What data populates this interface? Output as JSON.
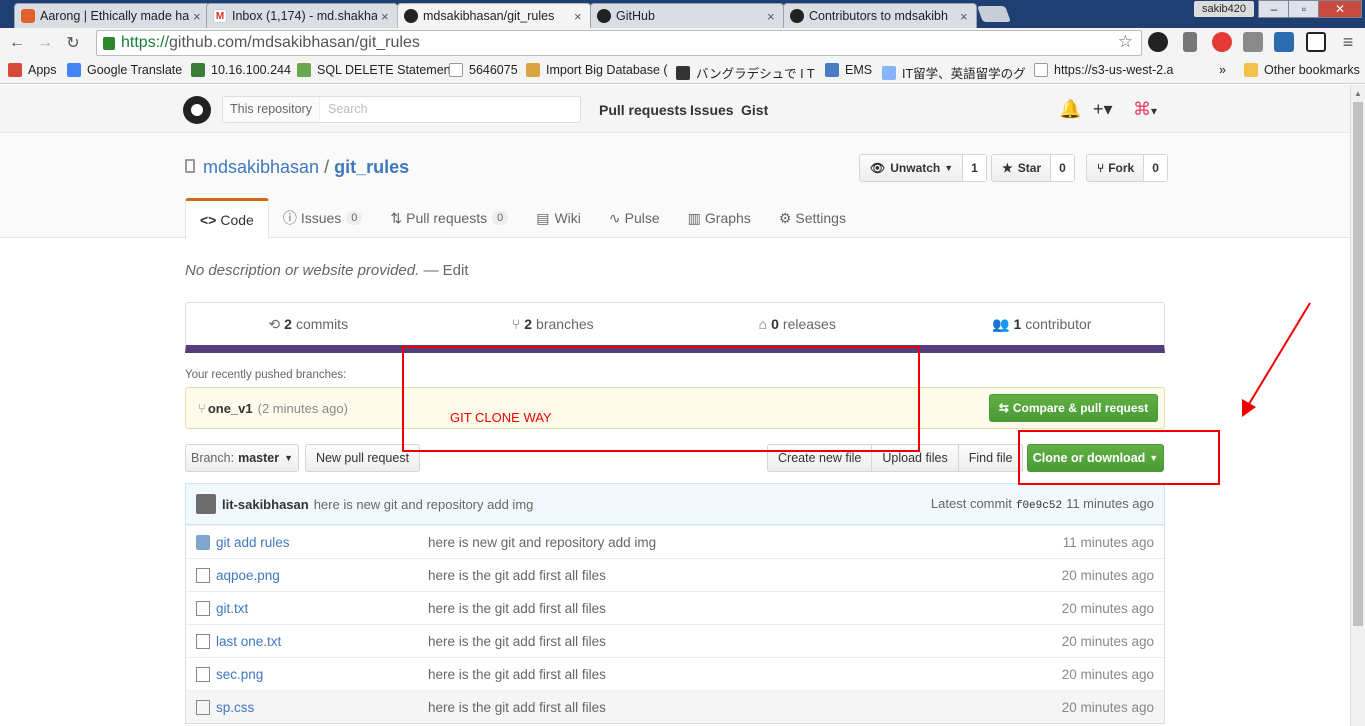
{
  "browser": {
    "tabs": [
      {
        "title": "Aarong | Ethically made ha",
        "favicon_color": "#e0632f"
      },
      {
        "title": "Inbox (1,174) - md.shakha",
        "favicon_color": "#d93025"
      },
      {
        "title": "mdsakibhasan/git_rules",
        "favicon_color": "#222222"
      },
      {
        "title": "GitHub",
        "favicon_color": "#222222"
      },
      {
        "title": "Contributors to mdsakibh",
        "favicon_color": "#222222"
      }
    ],
    "user_badge": "sakib420",
    "url_scheme": "https://",
    "url_rest": "github.com/mdsakibhasan/git_rules",
    "bookmarks": [
      {
        "label": "Apps",
        "color": "#d84a38"
      },
      {
        "label": "Google Translate",
        "color": "#4285f4"
      },
      {
        "label": "10.16.100.244",
        "color": "#3c7d3c"
      },
      {
        "label": "SQL DELETE Statemen",
        "color": "#6aa84f"
      },
      {
        "label": "5646075",
        "color": "#999999"
      },
      {
        "label": "Import Big Database (",
        "color": "#d9a441"
      },
      {
        "label": "バングラデシュで I T",
        "color": "#333333"
      },
      {
        "label": "EMS",
        "color": "#4a7cc0"
      },
      {
        "label": "IT留学、英語留学のグ",
        "color": "#8ab4f8"
      },
      {
        "label": "https://s3-us-west-2.a",
        "color": "#999999"
      }
    ],
    "bookmarks_overflow": "»",
    "other_bookmarks": "Other bookmarks"
  },
  "header": {
    "scope": "This repository",
    "search_placeholder": "Search",
    "nav": [
      "Pull requests",
      "Issues",
      "Gist"
    ]
  },
  "repo": {
    "owner": "mdsakibhasan",
    "name": "git_rules",
    "watch_label": "Unwatch",
    "watch_count": "1",
    "star_label": "Star",
    "star_count": "0",
    "fork_label": "Fork",
    "fork_count": "0",
    "tabs": [
      {
        "label": "Code",
        "count": ""
      },
      {
        "label": "Issues",
        "count": "0"
      },
      {
        "label": "Pull requests",
        "count": "0"
      },
      {
        "label": "Wiki",
        "count": ""
      },
      {
        "label": "Pulse",
        "count": ""
      },
      {
        "label": "Graphs",
        "count": ""
      },
      {
        "label": "Settings",
        "count": ""
      }
    ],
    "description": "No description or website provided.",
    "edit_label": "— Edit",
    "summary": {
      "commits_num": "2",
      "commits_label": "commits",
      "branches_num": "2",
      "branches_label": "branches",
      "releases_num": "0",
      "releases_label": "releases",
      "contributors_num": "1",
      "contributors_label": "contributor"
    },
    "language_color": "#563d7c",
    "recent_label": "Your recently pushed branches:",
    "recent_branch": "one_v1",
    "recent_time": "(2 minutes ago)",
    "compare_label": "Compare & pull request",
    "branch_prefix": "Branch:",
    "branch_name": "master",
    "new_pr_label": "New pull request",
    "create_file": "Create new file",
    "upload_files": "Upload files",
    "find_file": "Find file",
    "clone_label": "Clone or download",
    "commit": {
      "author": "lit-sakibhasan",
      "message": "here is new git and repository add img",
      "latest_label": "Latest commit",
      "sha": "f0e9c52",
      "time": "11 minutes ago"
    },
    "files": [
      {
        "type": "folder",
        "name": "git add rules",
        "message": "here is new git and repository add img",
        "age": "11 minutes ago"
      },
      {
        "type": "file",
        "name": "aqpoe.png",
        "message": "here is the git add first all files",
        "age": "20 minutes ago"
      },
      {
        "type": "file",
        "name": "git.txt",
        "message": "here is the git add first all files",
        "age": "20 minutes ago"
      },
      {
        "type": "file",
        "name": "last one.txt",
        "message": "here is the git add first all files",
        "age": "20 minutes ago"
      },
      {
        "type": "file",
        "name": "sec.png",
        "message": "here is the git add first all files",
        "age": "20 minutes ago"
      },
      {
        "type": "file",
        "name": "sp.css",
        "message": "here is the git add first all files",
        "age": "20 minutes ago"
      }
    ]
  },
  "annotation": {
    "text": "GIT CLONE WAY",
    "color": "#ee0000"
  }
}
